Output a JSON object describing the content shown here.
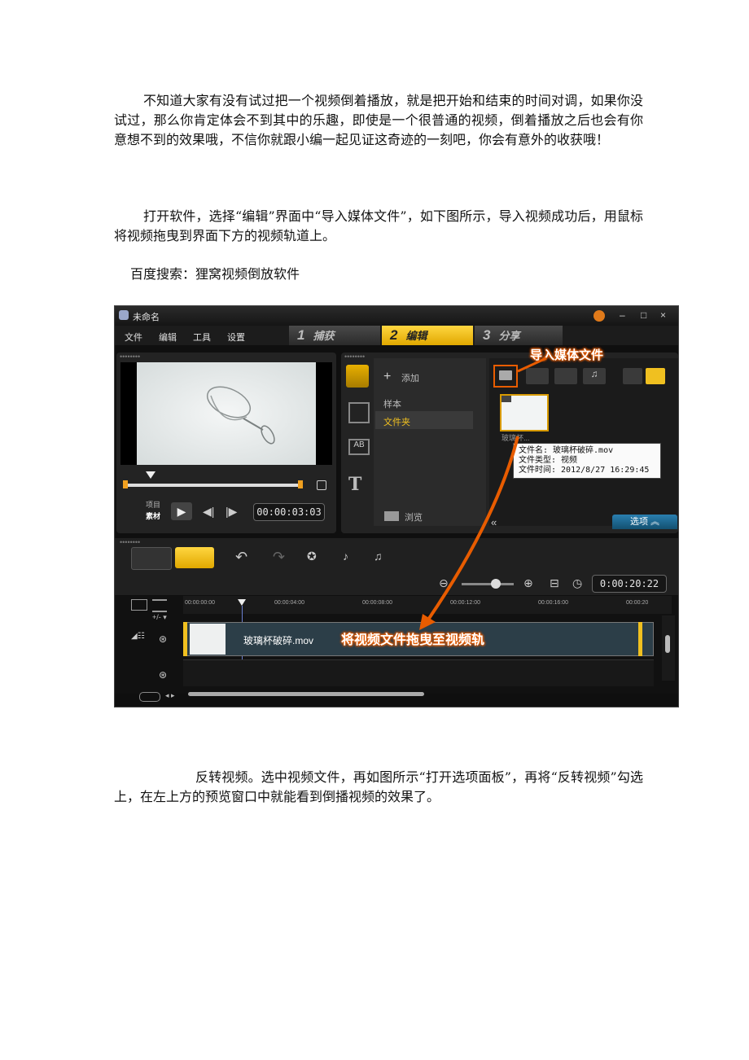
{
  "paragraphs": {
    "p1": "不知道大家有没有试过把一个视频倒着播放，就是把开始和结束的时间对调，如果你没试过，那么你肯定体会不到其中的乐趣，即使是一个很普通的视频，倒着播放之后也会有你意想不到的效果哦，不信你就跟小编一起见证这奇迹的一刻吧，你会有意外的收获哦！",
    "p2": "打开软件，选择“编辑”界面中“导入媒体文件”，如下图所示，导入视频成功后，用鼠标将视频拖曳到界面下方的视频轨道上。",
    "p3": "百度搜索：狸窝视频倒放软件",
    "p4": "反转视频。选中视频文件，再如图所示“打开选项面板”，再将“反转视频”勾选上，在左上方的预览窗口中就能看到倒播视频的效果了。"
  },
  "app": {
    "title": "未命名",
    "menu": [
      "文件",
      "编辑",
      "工具",
      "设置"
    ],
    "steps": [
      {
        "num": "1",
        "label": "捕获"
      },
      {
        "num": "2",
        "label": "编辑"
      },
      {
        "num": "3",
        "label": "分享"
      }
    ],
    "win_controls": [
      "–",
      "□",
      "×"
    ],
    "preview": {
      "project_label": "项目",
      "clip_label": "素材",
      "timecode": "00:00:03:03"
    },
    "library": {
      "add_label": "添加",
      "items": [
        "样本",
        "文件夹"
      ],
      "browse_label": "浏览",
      "thumb_caption": "玻璃杯...",
      "tooltip": {
        "line1": "文件名: 玻璃杯破碎.mov",
        "line2": "文件类型: 视频",
        "line3": "文件时间: 2012/8/27 16:29:45"
      },
      "options_label": "选项"
    },
    "callouts": {
      "import": "导入媒体文件",
      "drag": "将视频文件拖曳至视频轨"
    },
    "timeline": {
      "duration": "0:00:20:22",
      "ruler_ticks": [
        "00:00:00:00",
        "00:00:04:00",
        "00:00:08:00",
        "00:00:12:00",
        "00:00:16:00",
        "00:00:20"
      ],
      "clip_name": "玻璃杯破碎.mov",
      "track_controls": "+/- ▾"
    },
    "colors": {
      "accent": "#f0c020",
      "callout": "#e85c00",
      "options": "#1f6f9a"
    }
  }
}
